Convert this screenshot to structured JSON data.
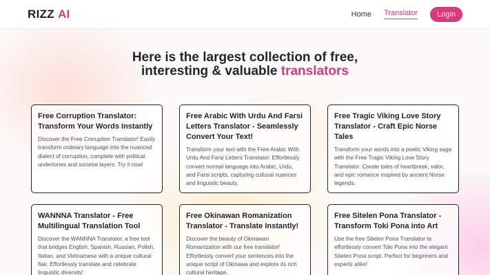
{
  "header": {
    "logo_main": "RIZZ",
    "logo_accent": "AI",
    "nav": {
      "home": "Home",
      "translator": "Translator",
      "login": "Login"
    }
  },
  "hero": {
    "line1": "Here is the largest collection of free,",
    "line2_prefix": "interesting & valuable",
    "line2_accent": "translators"
  },
  "colors": {
    "accent": "#d63b7a",
    "text": "#1f2430"
  },
  "cards": [
    {
      "title": "Free Corruption Translator: Transform Your Words Instantly",
      "desc": "Discover the Free Corruption Translator! Easily transform ordinary language into the nuanced dialect of corruption, complete with political undertones and societal layers. Try it now!"
    },
    {
      "title": "Free Arabic With Urdu And Farsi Letters Translator - Seamlessly Convert Your Text!",
      "desc": "Transform your text with the Free Arabic With Urdu And Farsi Letters Translator. Effortlessly convert normal language into Arabic, Urdu, and Farsi scripts, capturing cultural nuances and linguistic beauty."
    },
    {
      "title": "Free Tragic Viking Love Story Translator - Craft Epic Norse Tales",
      "desc": "Transform your words into a poetic Viking saga with the Free Tragic Viking Love Story Translator. Create tales of heartbreak, valor, and epic romance inspired by ancient Norse legends."
    },
    {
      "title": "WANNNA Translator - Free Multilingual Translation Tool",
      "desc": "Discover the WANNNA Translator, a free tool that bridges English, Spanish, Russian, Polish, Italian, and Vietnamese with a unique cultural flair. Effortlessly translate and celebrate linguistic diversity!"
    },
    {
      "title": "Free Okinawan Romanization Translator - Translate Instantly!",
      "desc": "Discover the beauty of Okinawan Romanization with our free translator! Effortlessly convert your sentences into the unique script of Okinawa and explore its rich cultural heritage."
    },
    {
      "title": "Free Sitelen Pona Translator - Transform Toki Pona into Art",
      "desc": "Use the free Sitelen Pona Translator to effortlessly convert Toki Pona into the elegant Sitelen Pona script. Perfect for beginners and experts alike!"
    }
  ]
}
